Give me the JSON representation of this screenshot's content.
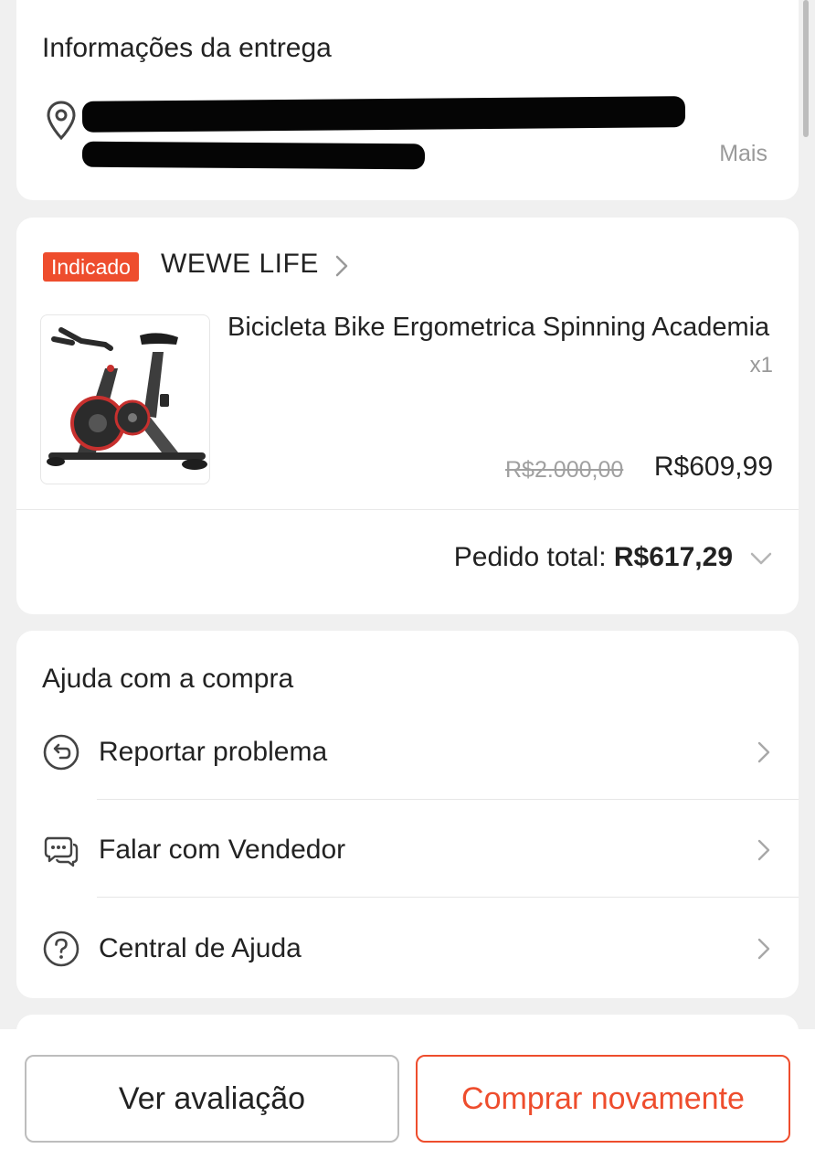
{
  "delivery": {
    "title": "Informações da entrega",
    "more": "Mais",
    "icon": "location-pin-icon"
  },
  "order": {
    "badge": "Indicado",
    "shop_name": "WEWE LIFE",
    "product_name": "Bicicleta Bike Ergometrica Spinning Academia",
    "quantity": "x1",
    "original_price": "R$2.000,00",
    "price": "R$609,99",
    "total_label": "Pedido total:",
    "total_value": "R$617,29"
  },
  "help": {
    "title": "Ajuda com a compra",
    "items": [
      {
        "label": "Reportar problema",
        "icon": "report-problem-icon"
      },
      {
        "label": "Falar com Vendedor",
        "icon": "chat-bubbles-icon"
      },
      {
        "label": "Central de Ajuda",
        "icon": "question-circle-icon"
      }
    ]
  },
  "actions": {
    "review_label": "Ver avaliação",
    "rebuy_label": "Comprar novamente"
  },
  "colors": {
    "accent": "#ee4d2d",
    "background": "#f0f0f0",
    "card": "#ffffff"
  }
}
